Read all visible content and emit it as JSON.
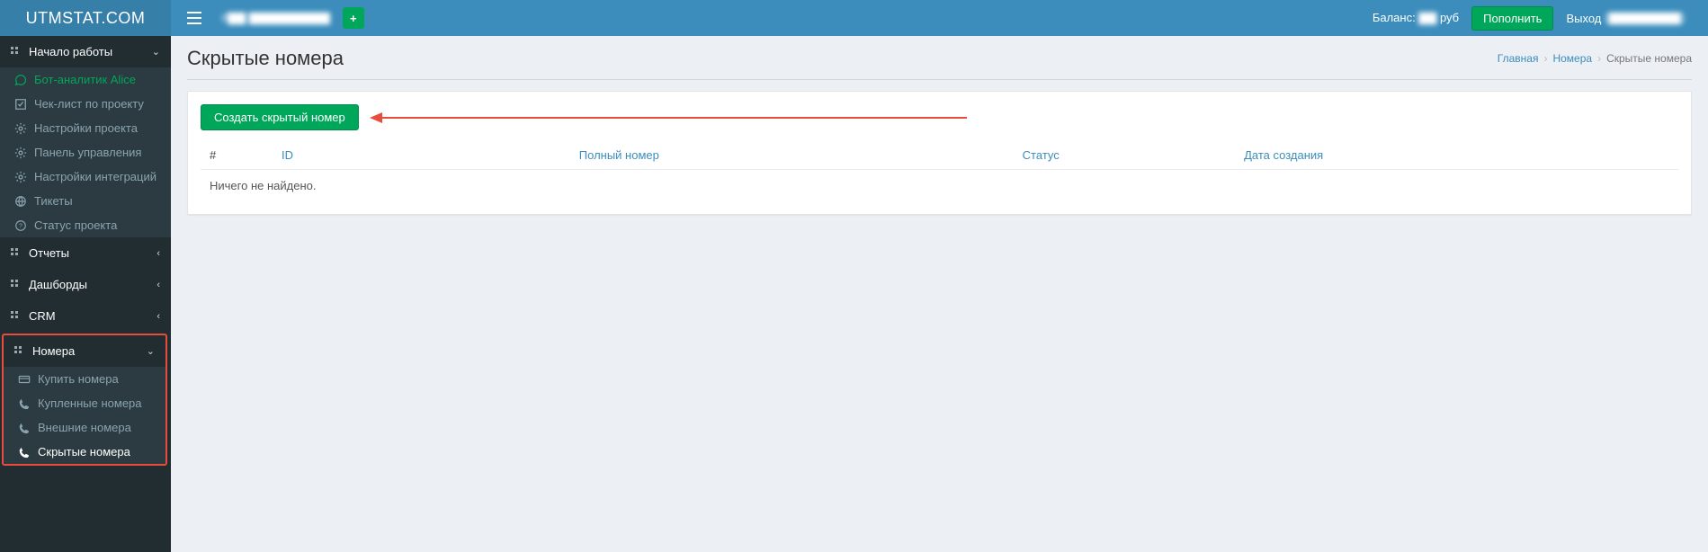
{
  "brand": "UTMSTAT.COM",
  "header": {
    "project_name": "#▇▇ ▇▇▇▇▇▇▇▇▇",
    "balance_label": "Баланс:",
    "balance_value": "▇▇",
    "balance_currency": "руб",
    "topup": "Пополнить",
    "signout": "Выход",
    "signout_suffix": "(▇▇▇▇▇▇▇▇)"
  },
  "sidebar": {
    "group_start": "Начало работы",
    "start_items": [
      {
        "label": "Бот-аналитик Alice",
        "icon": "chat-icon",
        "variant": "bot"
      },
      {
        "label": "Чек-лист по проекту",
        "icon": "check-icon"
      },
      {
        "label": "Настройки проекта",
        "icon": "gear-icon"
      },
      {
        "label": "Панель управления",
        "icon": "gear-icon"
      },
      {
        "label": "Настройки интеграций",
        "icon": "gear-icon"
      },
      {
        "label": "Тикеты",
        "icon": "globe-icon"
      },
      {
        "label": "Статус проекта",
        "icon": "question-icon"
      }
    ],
    "group_reports": "Отчеты",
    "group_dashboards": "Дашборды",
    "group_crm": "CRM",
    "group_numbers": "Номера",
    "numbers_items": [
      {
        "label": "Купить номера",
        "icon": "card-icon"
      },
      {
        "label": "Купленные номера",
        "icon": "phone-icon"
      },
      {
        "label": "Внешние номера",
        "icon": "phone-icon"
      },
      {
        "label": "Скрытые номера",
        "icon": "phone-icon",
        "active": true
      }
    ]
  },
  "page": {
    "title": "Скрытые номера",
    "breadcrumb": {
      "home": "Главная",
      "mid": "Номера",
      "current": "Скрытые номера"
    },
    "create_btn": "Создать скрытый номер",
    "table_headers": {
      "idx": "#",
      "id": "ID",
      "full_number": "Полный номер",
      "status": "Статус",
      "created": "Дата создания"
    },
    "empty": "Ничего не найдено."
  }
}
